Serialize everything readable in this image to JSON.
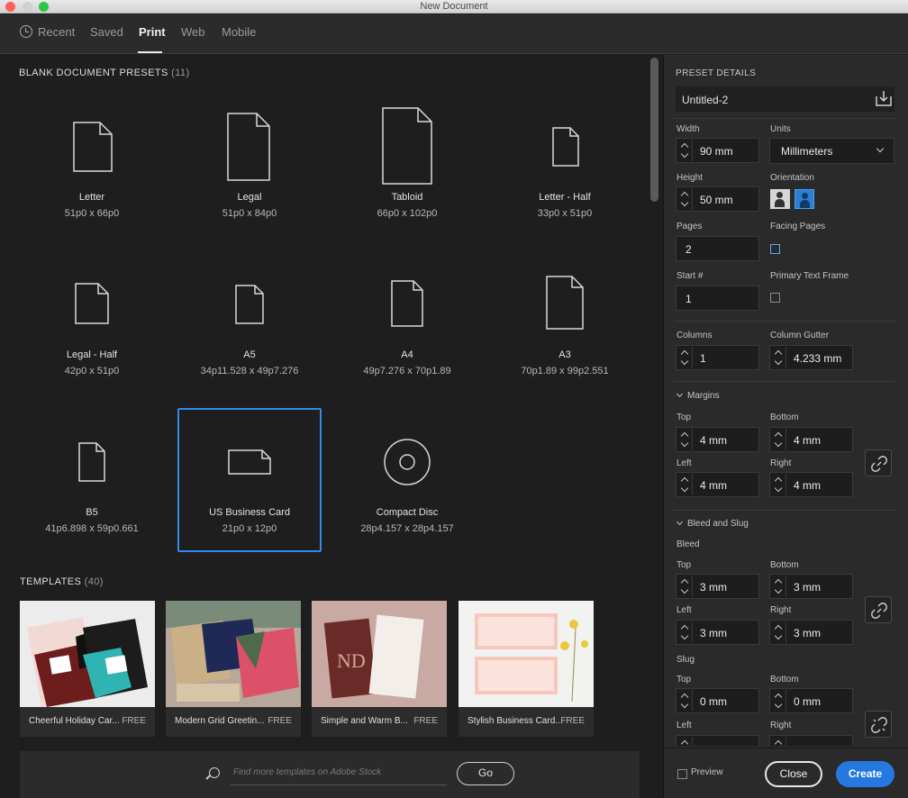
{
  "window": {
    "title": "New Document"
  },
  "tabs": [
    {
      "label": "Recent"
    },
    {
      "label": "Saved"
    },
    {
      "label": "Print"
    },
    {
      "label": "Web"
    },
    {
      "label": "Mobile"
    }
  ],
  "active_tab": "Print",
  "blank_presets": {
    "heading": "BLANK DOCUMENT PRESETS",
    "count": "(11)",
    "items": [
      {
        "name": "Letter",
        "dims": "51p0 x 66p0"
      },
      {
        "name": "Legal",
        "dims": "51p0 x 84p0"
      },
      {
        "name": "Tabloid",
        "dims": "66p0 x 102p0"
      },
      {
        "name": "Letter - Half",
        "dims": "33p0 x 51p0"
      },
      {
        "name": "Legal - Half",
        "dims": "42p0 x 51p0"
      },
      {
        "name": "A5",
        "dims": "34p11.528 x 49p7.276"
      },
      {
        "name": "A4",
        "dims": "49p7.276 x 70p1.89"
      },
      {
        "name": "A3",
        "dims": "70p1.89 x 99p2.551"
      },
      {
        "name": "B5",
        "dims": "41p6.898 x 59p0.661"
      },
      {
        "name": "US Business Card",
        "dims": "21p0 x 12p0"
      },
      {
        "name": "Compact Disc",
        "dims": "28p4.157 x 28p4.157"
      }
    ],
    "selected": "US Business Card"
  },
  "templates": {
    "heading": "TEMPLATES",
    "count": "(40)",
    "items": [
      {
        "title": "Cheerful Holiday Car...",
        "price": "FREE"
      },
      {
        "title": "Modern Grid Greetin...",
        "price": "FREE"
      },
      {
        "title": "Simple and Warm B...",
        "price": "FREE"
      },
      {
        "title": "Stylish Business Card...",
        "price": "FREE"
      }
    ],
    "search_placeholder": "Find more templates on Adobe Stock",
    "go_label": "Go"
  },
  "details": {
    "heading": "PRESET DETAILS",
    "doc_name": "Untitled-2",
    "width_label": "Width",
    "width_value": "90 mm",
    "units_label": "Units",
    "units_value": "Millimeters",
    "height_label": "Height",
    "height_value": "50 mm",
    "orientation_label": "Orientation",
    "pages_label": "Pages",
    "pages_value": "2",
    "facing_label": "Facing Pages",
    "start_label": "Start #",
    "start_value": "1",
    "primary_label": "Primary Text Frame",
    "columns_label": "Columns",
    "columns_value": "1",
    "gutter_label": "Column Gutter",
    "gutter_value": "4.233 mm",
    "margins": {
      "heading": "Margins",
      "top_label": "Top",
      "top": "4 mm",
      "bottom_label": "Bottom",
      "bottom": "4 mm",
      "left_label": "Left",
      "left": "4 mm",
      "right_label": "Right",
      "right": "4 mm"
    },
    "bleed_slug": {
      "heading": "Bleed and Slug",
      "bleed_label": "Bleed",
      "bleed_top_label": "Top",
      "bleed_top": "3 mm",
      "bleed_bottom_label": "Bottom",
      "bleed_bottom": "3 mm",
      "bleed_left_label": "Left",
      "bleed_left": "3 mm",
      "bleed_right_label": "Right",
      "bleed_right": "3 mm",
      "slug_label": "Slug",
      "slug_top_label": "Top",
      "slug_top": "0 mm",
      "slug_bottom_label": "Bottom",
      "slug_bottom": "0 mm",
      "slug_left_label": "Left",
      "slug_right_label": "Right"
    }
  },
  "footer": {
    "preview_label": "Preview",
    "close_label": "Close",
    "create_label": "Create"
  },
  "colors": {
    "accent": "#2478e0",
    "selection": "#2d8ceb"
  }
}
